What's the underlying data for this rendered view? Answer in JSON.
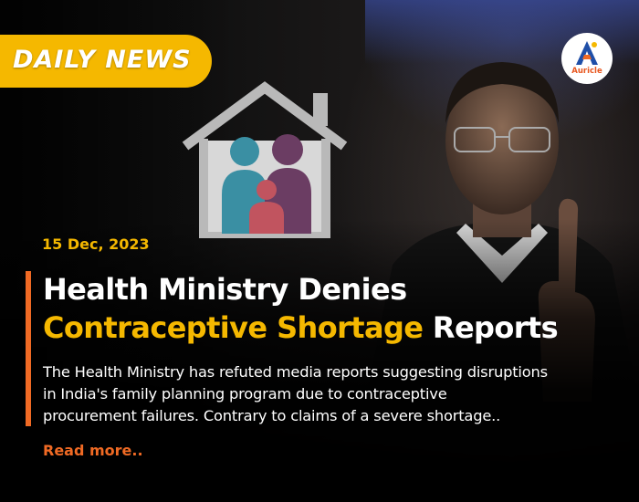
{
  "badge": {
    "label": "DAILY NEWS"
  },
  "brand": {
    "logo_text": "Auricle"
  },
  "article": {
    "date": "15 Dec, 2023",
    "headline": {
      "line1": "Health Ministry Denies",
      "line2_highlight": "Contraceptive Shortage",
      "line2_rest": " Reports"
    },
    "body_lines": [
      "The Health Ministry has refuted media reports suggesting disruptions",
      "in India's family planning program due to contraceptive",
      "procurement failures. Contrary to claims of a severe shortage.."
    ],
    "read_more": "Read more.."
  },
  "colors": {
    "accent_yellow": "#f5b800",
    "accent_orange": "#f06a24",
    "text_white": "#ffffff",
    "background": "#000000"
  },
  "icons": {
    "family_home": "family-home-icon",
    "brand": "auricle-logo-icon"
  }
}
